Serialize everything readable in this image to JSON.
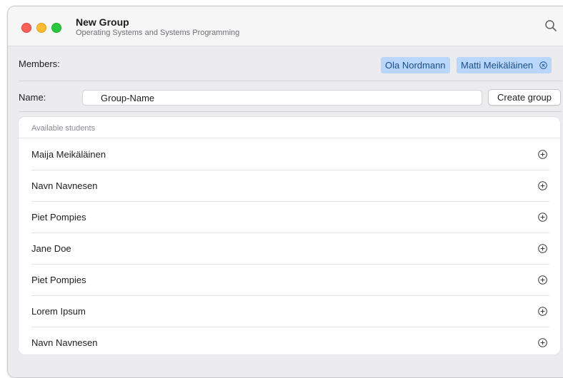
{
  "window": {
    "title": "New Group",
    "subtitle": "Operating Systems and Systems Programming"
  },
  "members": {
    "label": "Members:",
    "chips": [
      "Ola Nordmann",
      "Matti Meikäläinen"
    ],
    "chip_color": "#b9d6fb",
    "chip_text_color": "#1a4f87"
  },
  "name": {
    "label": "Name:",
    "value": "Group-Name"
  },
  "create_button_label": "Create group",
  "students": {
    "header": "Available students",
    "items": [
      "Maija Meikäläinen",
      "Navn Navnesen",
      "Piet Pompies",
      "Jane Doe",
      "Piet Pompies",
      "Lorem Ipsum",
      "Navn Navnesen"
    ]
  }
}
